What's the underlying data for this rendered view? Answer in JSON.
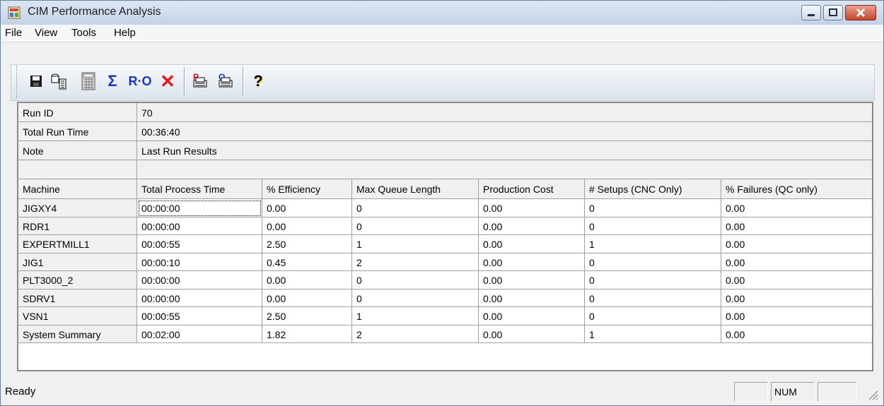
{
  "window": {
    "title": "CIM Performance Analysis"
  },
  "menu": {
    "items": [
      "File",
      "View",
      "Tools",
      "Help"
    ]
  },
  "toolbar": {
    "buttons": [
      {
        "name": "save-icon"
      },
      {
        "name": "export-icon"
      },
      {
        "name": "calculator-icon"
      },
      {
        "name": "sum-icon"
      },
      {
        "name": "run-options-icon"
      },
      {
        "name": "delete-icon"
      },
      {
        "name": "print-preview-icon"
      },
      {
        "name": "print-icon"
      },
      {
        "name": "help-icon"
      }
    ],
    "sum_glyph": "Σ",
    "ro_glyph": "R·O",
    "delete_glyph": "✕",
    "help_glyph": "?"
  },
  "run_info": {
    "rows": [
      {
        "label": "Run ID",
        "value": "70"
      },
      {
        "label": "Total Run Time",
        "value": "00:36:40"
      },
      {
        "label": "Note",
        "value": "Last Run Results"
      }
    ]
  },
  "table": {
    "headers": [
      "Machine",
      "Total Process Time",
      "% Efficiency",
      "Max Queue Length",
      "Production Cost",
      "# Setups (CNC Only)",
      "% Failures (QC only)"
    ],
    "rows": [
      [
        "JIGXY4",
        "00:00:00",
        "0.00",
        "0",
        "0.00",
        "0",
        "0.00"
      ],
      [
        "RDR1",
        "00:00:00",
        "0.00",
        "0",
        "0.00",
        "0",
        "0.00"
      ],
      [
        "EXPERTMILL1",
        "00:00:55",
        "2.50",
        "1",
        "0.00",
        "1",
        "0.00"
      ],
      [
        "JIG1",
        "00:00:10",
        "0.45",
        "2",
        "0.00",
        "0",
        "0.00"
      ],
      [
        "PLT3000_2",
        "00:00:00",
        "0.00",
        "0",
        "0.00",
        "0",
        "0.00"
      ],
      [
        "SDRV1",
        "00:00:00",
        "0.00",
        "0",
        "0.00",
        "0",
        "0.00"
      ],
      [
        "VSN1",
        "00:00:55",
        "2.50",
        "1",
        "0.00",
        "0",
        "0.00"
      ],
      [
        "System Summary",
        "00:02:00",
        "1.82",
        "2",
        "0.00",
        "1",
        "0.00"
      ]
    ]
  },
  "status": {
    "text": "Ready",
    "num": "NUM"
  },
  "colors": {
    "title_bg": "#c3d3e6",
    "close_red": "#c4452b",
    "grid_line": "#a0a0a0"
  }
}
